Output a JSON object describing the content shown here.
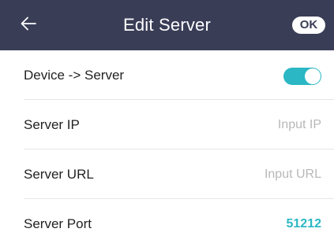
{
  "header": {
    "title": "Edit Server",
    "ok_label": "OK",
    "back_icon": "arrow-left-icon",
    "background_color": "#3a3d56"
  },
  "settings": {
    "device_to_server": {
      "label": "Device -> Server",
      "enabled": true,
      "accent_color": "#2bb7c4"
    },
    "server_ip": {
      "label": "Server IP",
      "value": "",
      "placeholder": "Input IP"
    },
    "server_url": {
      "label": "Server URL",
      "value": "",
      "placeholder": "Input URL"
    },
    "server_port": {
      "label": "Server Port",
      "value": "51212"
    }
  }
}
